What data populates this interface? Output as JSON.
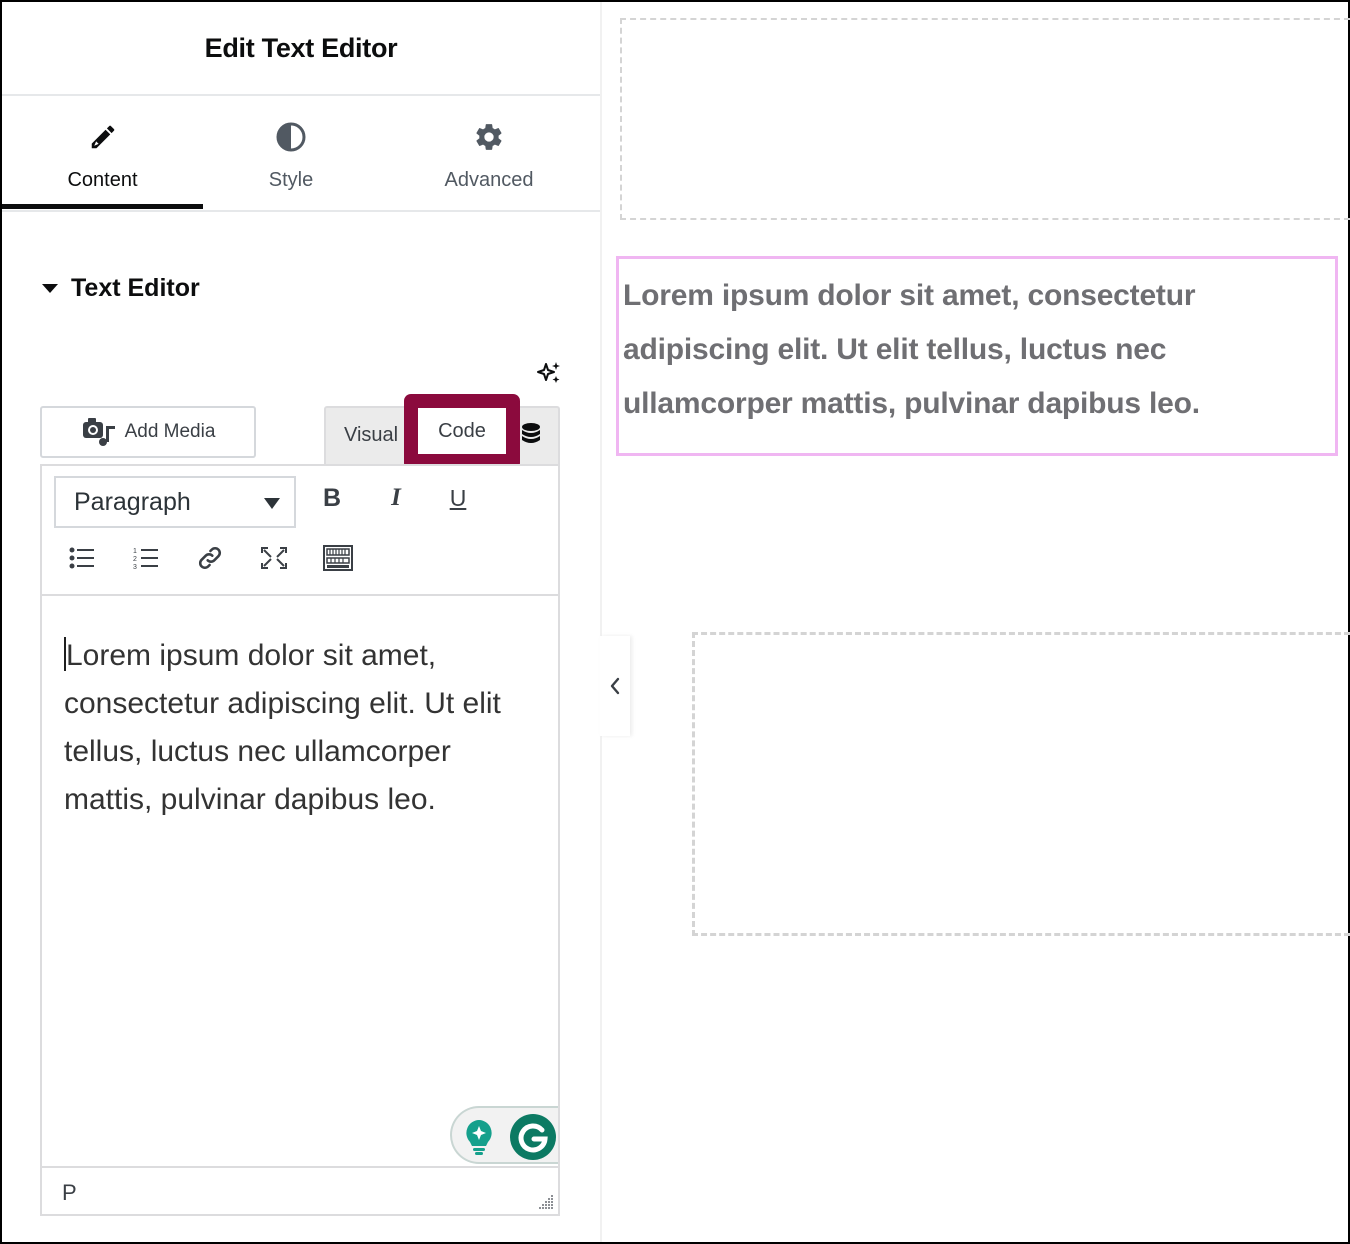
{
  "panel": {
    "title": "Edit Text Editor",
    "tabs": [
      {
        "label": "Content",
        "icon": "pencil-icon",
        "active": true
      },
      {
        "label": "Style",
        "icon": "contrast-icon",
        "active": false
      },
      {
        "label": "Advanced",
        "icon": "gear-icon",
        "active": false
      }
    ],
    "section_title": "Text Editor"
  },
  "editor": {
    "add_media_label": "Add Media",
    "modes": {
      "visual": "Visual",
      "code": "Code",
      "highlighted": "Code"
    },
    "format_select_value": "Paragraph",
    "toolbar": {
      "bold": "B",
      "italic": "I",
      "underline": "U"
    },
    "content": "Lorem ipsum dolor sit amet, consectetur adipiscing elit. Ut elit tellus, luctus nec ullamcorper mattis, pulvinar dapibus leo.",
    "status_path": "P"
  },
  "preview": {
    "text": "Lorem ipsum dolor sit amet, consectetur adipiscing elit. Ut elit tellus, luctus nec ullamcorper mattis, pulvinar dapibus leo."
  },
  "colors": {
    "highlight": "#8b0a3d",
    "selected_widget_border": "#f0b6f2",
    "grammarly_green": "#15a08c",
    "grammarly_dark": "#0c7a63"
  }
}
